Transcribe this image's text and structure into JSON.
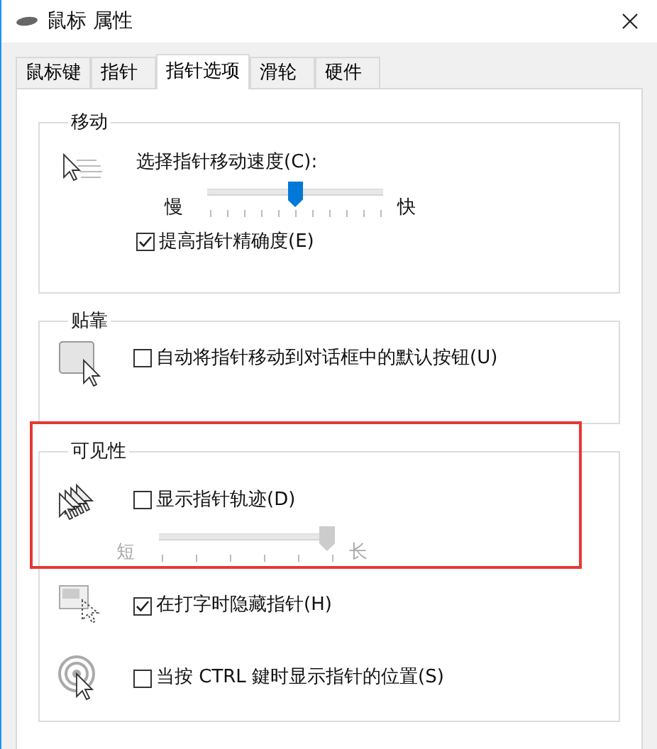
{
  "window": {
    "title": "鼠标 属性"
  },
  "tabs": [
    {
      "label": "鼠标键",
      "selected": false
    },
    {
      "label": "指针",
      "selected": false
    },
    {
      "label": "指针选项",
      "selected": true
    },
    {
      "label": "滑轮",
      "selected": false
    },
    {
      "label": "硬件",
      "selected": false
    }
  ],
  "motion": {
    "title": "移动",
    "label": "选择指针移动速度(C):",
    "slider": {
      "min_label": "慢",
      "max_label": "快",
      "level": 0.5,
      "disabled": false
    },
    "checkbox": {
      "label": "提高指针精确度(E)",
      "checked": true
    }
  },
  "snap_to": {
    "title": "贴靠",
    "checkbox": {
      "label": "自动将指针移动到对话框中的默认按钮(U)",
      "checked": false
    }
  },
  "visibility": {
    "title": "可见性",
    "trails": {
      "label": "显示指针轨迹(D)",
      "checked": false
    },
    "slider": {
      "min_label": "短",
      "max_label": "长",
      "level": 1,
      "disabled": true
    },
    "options": [
      {
        "kind": "hide",
        "label": "在打字时隐藏指针(H)",
        "checked": true
      },
      {
        "kind": "locate",
        "label": "当按 CTRL 鍵时显示指针的位置(S)",
        "checked": false
      }
    ]
  },
  "highlighted": true
}
